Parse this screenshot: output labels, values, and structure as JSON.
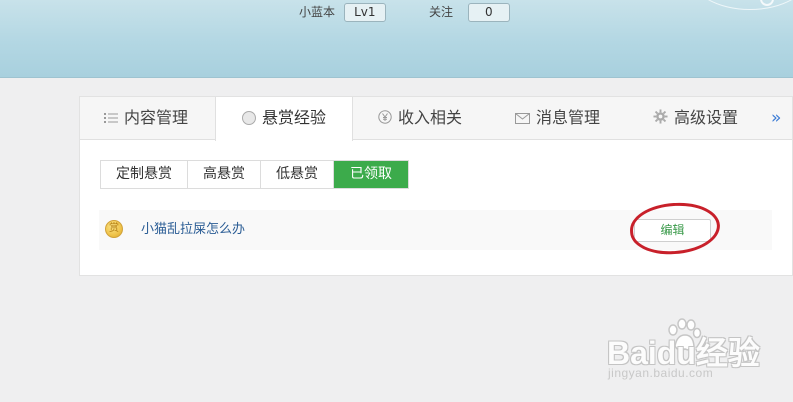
{
  "header": {
    "username": "小蓝本",
    "level": "Lv1",
    "follow_label": "关注",
    "follow_count": "0"
  },
  "tabs": [
    {
      "label": "内容管理",
      "icon": "list-icon"
    },
    {
      "label": "悬赏经验",
      "icon": "coin-icon",
      "active": true
    },
    {
      "label": "收入相关",
      "icon": "yen-icon"
    },
    {
      "label": "消息管理",
      "icon": "mail-icon"
    },
    {
      "label": "高级设置",
      "icon": "gear-icon"
    },
    {
      "label": "»",
      "icon": "double-chevron-right-icon"
    }
  ],
  "subtabs": [
    {
      "label": "定制悬赏"
    },
    {
      "label": "高悬赏"
    },
    {
      "label": "低悬赏"
    },
    {
      "label": "已领取",
      "active": true
    }
  ],
  "rows": [
    {
      "title": "小猫乱拉屎怎么办",
      "icon": "gold-coin-icon",
      "icon_glyph": "赏",
      "action": "编辑"
    }
  ],
  "watermark": {
    "brand": "Baidu经验",
    "url": "jingyan.baidu.com"
  },
  "colors": {
    "accent_green": "#3cab4b",
    "link_blue": "#2b5d95",
    "annotation_red": "#c8202a"
  }
}
